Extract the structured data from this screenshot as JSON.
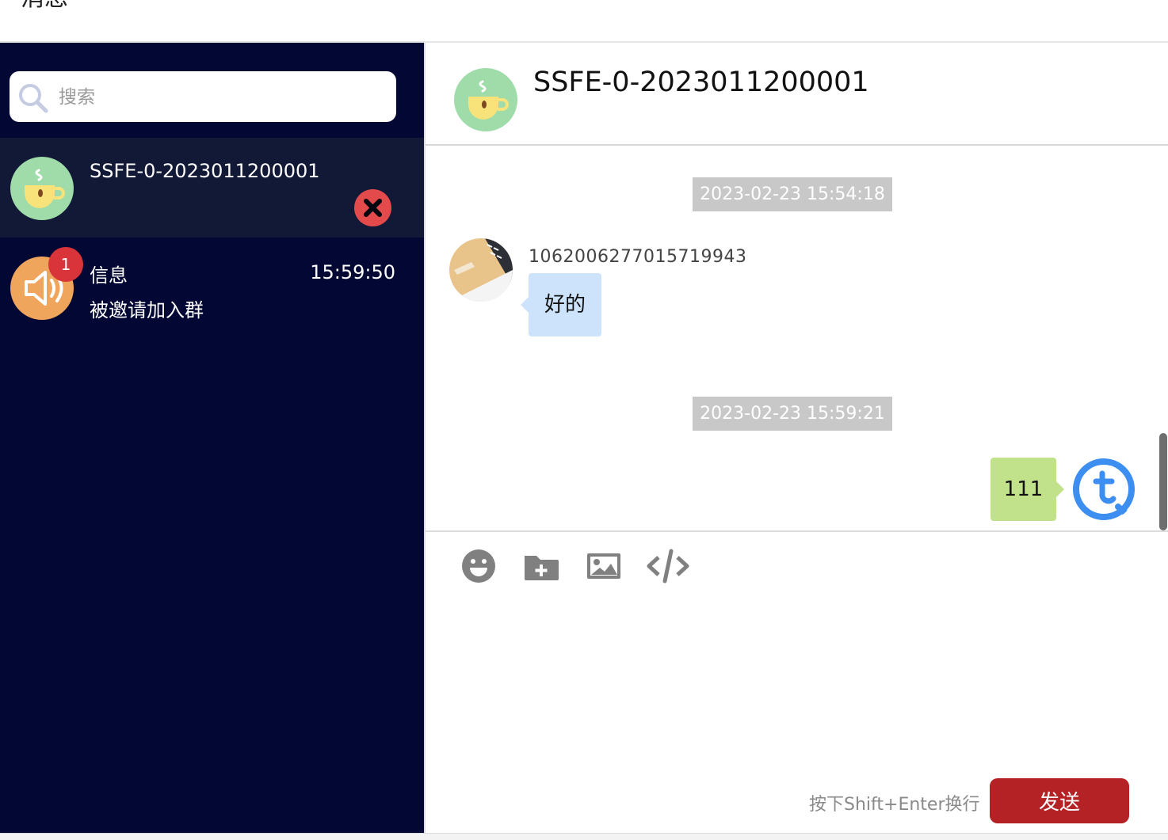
{
  "page": {
    "title": "消息"
  },
  "search": {
    "placeholder": "搜索"
  },
  "conversations": [
    {
      "name": "SSFE-0-2023011200001",
      "active": true,
      "avatar_icon": "coffee-cup-icon"
    },
    {
      "name": "信息",
      "time": "15:59:50",
      "preview": "被邀请加入群",
      "badge": "1",
      "avatar_icon": "speaker-icon"
    }
  ],
  "chat": {
    "title": "SSFE-0-2023011200001",
    "messages": [
      {
        "timestamp": "2023-02-23 15:54:18",
        "sender": "1062006277015719943",
        "text": "好的",
        "direction": "incoming"
      },
      {
        "timestamp": "2023-02-23 15:59:21",
        "text": "111",
        "direction": "outgoing"
      }
    ]
  },
  "composer": {
    "tools": [
      "emoji-icon",
      "folder-add-icon",
      "image-icon",
      "code-icon"
    ],
    "hint": "按下Shift+Enter换行",
    "send_label": "发送"
  },
  "colors": {
    "sidebar_bg": "#020733",
    "active_item_bg": "#121937",
    "send_button": "#b52225",
    "incoming_bubble": "#cce3fb",
    "outgoing_bubble": "#c1e28b",
    "badge": "#d8343a"
  }
}
